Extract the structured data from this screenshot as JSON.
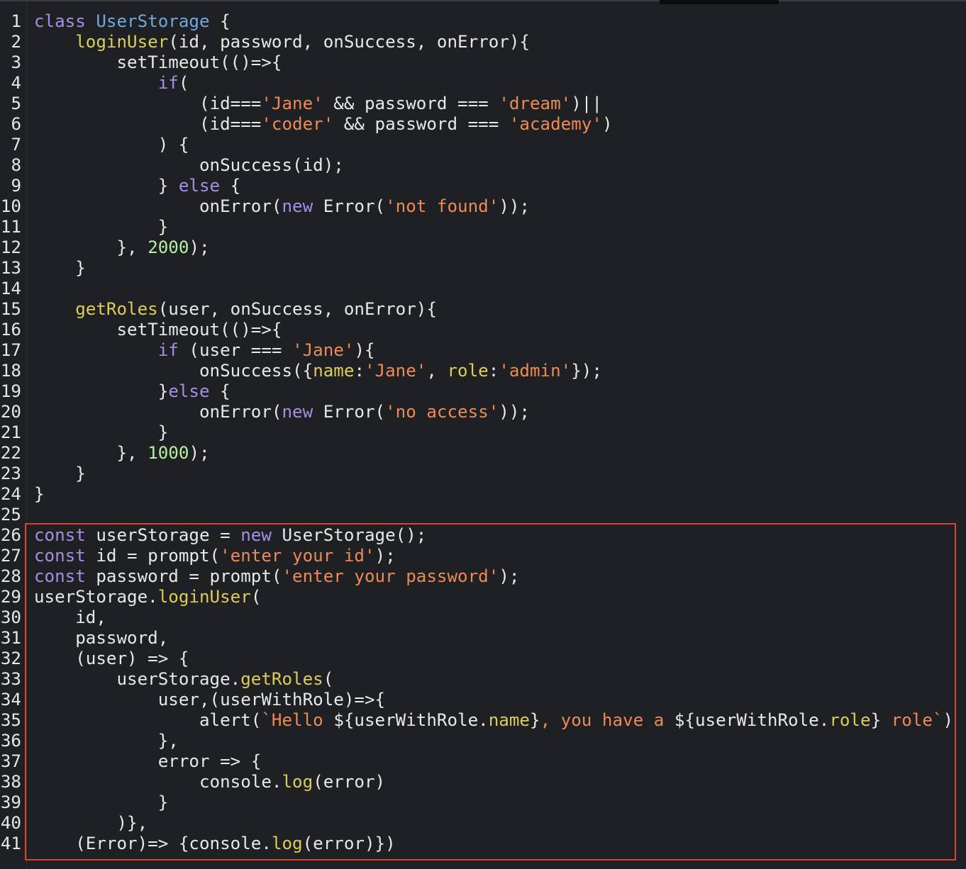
{
  "editor": {
    "highlight_label": "",
    "lines": [
      {
        "n": "1",
        "tokens": [
          {
            "t": "class ",
            "c": "k"
          },
          {
            "t": "UserStorage",
            "c": "c"
          },
          {
            "t": " {",
            "c": "p"
          }
        ]
      },
      {
        "n": "2",
        "tokens": [
          {
            "t": "    ",
            "c": "p"
          },
          {
            "t": "loginUser",
            "c": "f"
          },
          {
            "t": "(id, password, onSuccess, onError){",
            "c": "p"
          }
        ]
      },
      {
        "n": "3",
        "tokens": [
          {
            "t": "        setTimeout(()=>{",
            "c": "p"
          }
        ]
      },
      {
        "n": "4",
        "tokens": [
          {
            "t": "            ",
            "c": "p"
          },
          {
            "t": "if",
            "c": "k"
          },
          {
            "t": "(",
            "c": "p"
          }
        ]
      },
      {
        "n": "5",
        "tokens": [
          {
            "t": "                (id===",
            "c": "p"
          },
          {
            "t": "'Jane'",
            "c": "s"
          },
          {
            "t": " && password === ",
            "c": "p"
          },
          {
            "t": "'dream'",
            "c": "s"
          },
          {
            "t": ")||",
            "c": "p"
          }
        ]
      },
      {
        "n": "6",
        "tokens": [
          {
            "t": "                (id===",
            "c": "p"
          },
          {
            "t": "'coder'",
            "c": "s"
          },
          {
            "t": " && password === ",
            "c": "p"
          },
          {
            "t": "'academy'",
            "c": "s"
          },
          {
            "t": ")",
            "c": "p"
          }
        ]
      },
      {
        "n": "7",
        "tokens": [
          {
            "t": "            ) {",
            "c": "p"
          }
        ]
      },
      {
        "n": "8",
        "tokens": [
          {
            "t": "                onSuccess(id);",
            "c": "p"
          }
        ]
      },
      {
        "n": "9",
        "tokens": [
          {
            "t": "            } ",
            "c": "p"
          },
          {
            "t": "else",
            "c": "k"
          },
          {
            "t": " {",
            "c": "p"
          }
        ]
      },
      {
        "n": "10",
        "tokens": [
          {
            "t": "                onError(",
            "c": "p"
          },
          {
            "t": "new",
            "c": "k"
          },
          {
            "t": " Error(",
            "c": "p"
          },
          {
            "t": "'not found'",
            "c": "s"
          },
          {
            "t": "));",
            "c": "p"
          }
        ]
      },
      {
        "n": "11",
        "tokens": [
          {
            "t": "            }",
            "c": "p"
          }
        ]
      },
      {
        "n": "12",
        "tokens": [
          {
            "t": "        }, ",
            "c": "p"
          },
          {
            "t": "2000",
            "c": "n"
          },
          {
            "t": ");",
            "c": "p"
          }
        ]
      },
      {
        "n": "13",
        "tokens": [
          {
            "t": "    }",
            "c": "p"
          }
        ]
      },
      {
        "n": "14",
        "tokens": [
          {
            "t": "",
            "c": "p"
          }
        ]
      },
      {
        "n": "15",
        "tokens": [
          {
            "t": "    ",
            "c": "p"
          },
          {
            "t": "getRoles",
            "c": "f"
          },
          {
            "t": "(user, onSuccess, onError){",
            "c": "p"
          }
        ]
      },
      {
        "n": "16",
        "tokens": [
          {
            "t": "        setTimeout(()=>{",
            "c": "p"
          }
        ]
      },
      {
        "n": "17",
        "tokens": [
          {
            "t": "            ",
            "c": "p"
          },
          {
            "t": "if",
            "c": "k"
          },
          {
            "t": " (user === ",
            "c": "p"
          },
          {
            "t": "'Jane'",
            "c": "s"
          },
          {
            "t": "){",
            "c": "p"
          }
        ]
      },
      {
        "n": "18",
        "tokens": [
          {
            "t": "                onSuccess({",
            "c": "p"
          },
          {
            "t": "name",
            "c": "f"
          },
          {
            "t": ":",
            "c": "p"
          },
          {
            "t": "'Jane'",
            "c": "s"
          },
          {
            "t": ", ",
            "c": "p"
          },
          {
            "t": "role",
            "c": "f"
          },
          {
            "t": ":",
            "c": "p"
          },
          {
            "t": "'admin'",
            "c": "s"
          },
          {
            "t": "});",
            "c": "p"
          }
        ]
      },
      {
        "n": "19",
        "tokens": [
          {
            "t": "            }",
            "c": "p"
          },
          {
            "t": "else",
            "c": "k"
          },
          {
            "t": " {",
            "c": "p"
          }
        ]
      },
      {
        "n": "20",
        "tokens": [
          {
            "t": "                onError(",
            "c": "p"
          },
          {
            "t": "new",
            "c": "k"
          },
          {
            "t": " Error(",
            "c": "p"
          },
          {
            "t": "'no access'",
            "c": "s"
          },
          {
            "t": "));",
            "c": "p"
          }
        ]
      },
      {
        "n": "21",
        "tokens": [
          {
            "t": "            }",
            "c": "p"
          }
        ]
      },
      {
        "n": "22",
        "tokens": [
          {
            "t": "        }, ",
            "c": "p"
          },
          {
            "t": "1000",
            "c": "n"
          },
          {
            "t": ");",
            "c": "p"
          }
        ]
      },
      {
        "n": "23",
        "tokens": [
          {
            "t": "    }",
            "c": "p"
          }
        ]
      },
      {
        "n": "24",
        "tokens": [
          {
            "t": "}",
            "c": "p"
          }
        ]
      },
      {
        "n": "25",
        "tokens": [
          {
            "t": "",
            "c": "p"
          }
        ]
      },
      {
        "n": "26",
        "tokens": [
          {
            "t": "const",
            "c": "k"
          },
          {
            "t": " userStorage = ",
            "c": "p"
          },
          {
            "t": "new",
            "c": "k"
          },
          {
            "t": " UserStorage();",
            "c": "p"
          }
        ]
      },
      {
        "n": "27",
        "tokens": [
          {
            "t": "const",
            "c": "k"
          },
          {
            "t": " id = prompt(",
            "c": "p"
          },
          {
            "t": "'enter your id'",
            "c": "s"
          },
          {
            "t": ");",
            "c": "p"
          }
        ]
      },
      {
        "n": "28",
        "tokens": [
          {
            "t": "const",
            "c": "k"
          },
          {
            "t": " password = prompt(",
            "c": "p"
          },
          {
            "t": "'enter your password'",
            "c": "s"
          },
          {
            "t": ");",
            "c": "p"
          }
        ]
      },
      {
        "n": "29",
        "tokens": [
          {
            "t": "userStorage.",
            "c": "p"
          },
          {
            "t": "loginUser",
            "c": "f"
          },
          {
            "t": "(",
            "c": "p"
          }
        ]
      },
      {
        "n": "30",
        "tokens": [
          {
            "t": "    id,",
            "c": "p"
          }
        ]
      },
      {
        "n": "31",
        "tokens": [
          {
            "t": "    password,",
            "c": "p"
          }
        ]
      },
      {
        "n": "32",
        "tokens": [
          {
            "t": "    (user) => {",
            "c": "p"
          }
        ]
      },
      {
        "n": "33",
        "tokens": [
          {
            "t": "        userStorage.",
            "c": "p"
          },
          {
            "t": "getRoles",
            "c": "f"
          },
          {
            "t": "(",
            "c": "p"
          }
        ]
      },
      {
        "n": "34",
        "tokens": [
          {
            "t": "            user,(userWithRole)=>{",
            "c": "p"
          }
        ]
      },
      {
        "n": "35",
        "tokens": [
          {
            "t": "                alert(",
            "c": "p"
          },
          {
            "t": "`Hello ",
            "c": "s"
          },
          {
            "t": "${userWithRole.",
            "c": "p"
          },
          {
            "t": "name",
            "c": "f"
          },
          {
            "t": "}",
            "c": "p"
          },
          {
            "t": ", you have a ",
            "c": "s"
          },
          {
            "t": "${userWithRole.",
            "c": "p"
          },
          {
            "t": "role",
            "c": "f"
          },
          {
            "t": "}",
            "c": "p"
          },
          {
            "t": " role`",
            "c": "s"
          },
          {
            "t": ")",
            "c": "p"
          }
        ]
      },
      {
        "n": "36",
        "tokens": [
          {
            "t": "            },",
            "c": "p"
          }
        ]
      },
      {
        "n": "37",
        "tokens": [
          {
            "t": "            error => {",
            "c": "p"
          }
        ]
      },
      {
        "n": "38",
        "tokens": [
          {
            "t": "                console.",
            "c": "p"
          },
          {
            "t": "log",
            "c": "f"
          },
          {
            "t": "(error)",
            "c": "p"
          }
        ]
      },
      {
        "n": "39",
        "tokens": [
          {
            "t": "            }",
            "c": "p"
          }
        ]
      },
      {
        "n": "40",
        "tokens": [
          {
            "t": "        )},",
            "c": "p"
          }
        ]
      },
      {
        "n": "41",
        "tokens": [
          {
            "t": "    (Error)=> {console.",
            "c": "p"
          },
          {
            "t": "log",
            "c": "f"
          },
          {
            "t": "(error)})",
            "c": "p"
          }
        ]
      }
    ]
  }
}
